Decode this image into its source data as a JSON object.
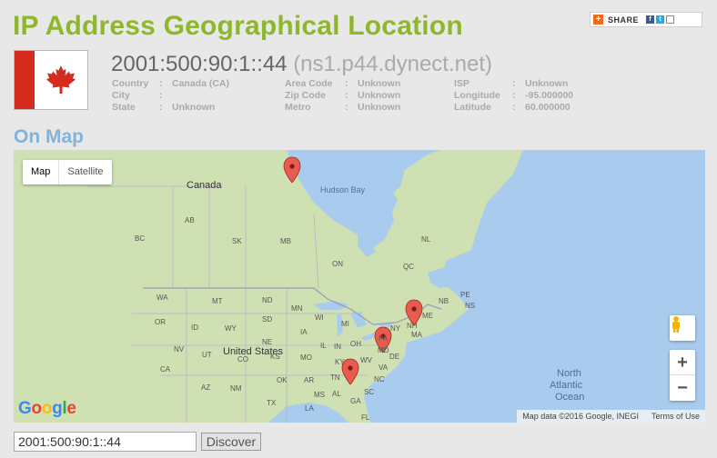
{
  "page": {
    "title": "IP Address Geographical Location",
    "share_label": "SHARE"
  },
  "ip": {
    "address": "2001:500:90:1::44",
    "host": "(ns1.p44.dynect.net)"
  },
  "details": {
    "col1": [
      {
        "label": "Country",
        "value": "Canada (CA)"
      },
      {
        "label": "City",
        "value": ""
      },
      {
        "label": "State",
        "value": "Unknown"
      }
    ],
    "col2": [
      {
        "label": "Area Code",
        "value": "Unknown"
      },
      {
        "label": "Zip Code",
        "value": "Unknown"
      },
      {
        "label": "Metro",
        "value": "Unknown"
      }
    ],
    "col3": [
      {
        "label": "ISP",
        "value": "Unknown"
      },
      {
        "label": "Longitude",
        "value": "-95.000000"
      },
      {
        "label": "Latitude",
        "value": "60.000000"
      }
    ]
  },
  "map": {
    "section_title": "On Map",
    "type_map": "Map",
    "type_satellite": "Satellite",
    "zoom_in": "+",
    "zoom_out": "−",
    "google_logo": "Google",
    "attribution": "Map data ©2016 Google, INEGI",
    "terms": "Terms of Use",
    "labels": {
      "canada": "Canada",
      "hudson_bay": "Hudson Bay",
      "united_states": "United States",
      "ocean_line1": "North",
      "ocean_line2": "Atlantic",
      "ocean_line3": "Ocean",
      "ab": "AB",
      "bc": "BC",
      "sk": "SK",
      "mb": "MB",
      "on": "ON",
      "qc": "QC",
      "nl": "NL",
      "nb": "NB",
      "ns": "NS",
      "pe": "PE",
      "wa": "WA",
      "mt": "MT",
      "nd": "ND",
      "mn": "MN",
      "me": "ME",
      "or": "OR",
      "id": "ID",
      "sd": "SD",
      "wi": "WI",
      "mi": "MI",
      "nh": "NH",
      "wy": "WY",
      "ia": "IA",
      "ny": "NY",
      "ma": "MA",
      "nv": "NV",
      "ne": "NE",
      "il": "IL",
      "oh": "OH",
      "pa": "PA",
      "ca": "CA",
      "ut": "UT",
      "co": "CO",
      "ks": "KS",
      "mo": "MO",
      "in": "IN",
      "wv": "WV",
      "md": "MD",
      "de": "DE",
      "ky": "KY",
      "va": "VA",
      "az": "AZ",
      "nm": "NM",
      "ok": "OK",
      "ar": "AR",
      "tn": "TN",
      "nc": "NC",
      "ms": "MS",
      "al": "AL",
      "sc": "SC",
      "tx": "TX",
      "la": "LA",
      "ga": "GA",
      "fl": "FL"
    }
  },
  "search": {
    "value": "2001:500:90:1::44",
    "button": "Discover"
  }
}
